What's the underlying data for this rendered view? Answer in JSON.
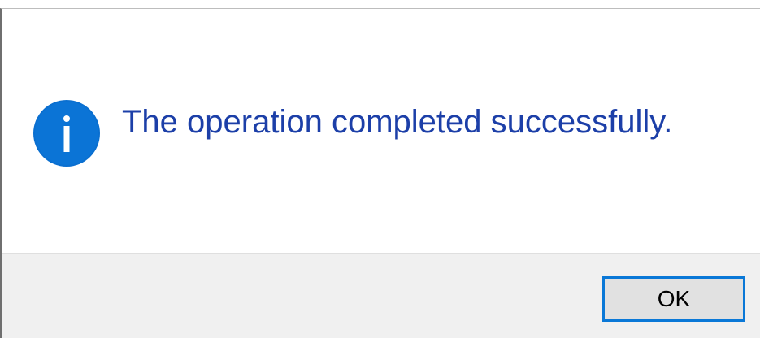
{
  "dialog": {
    "message": "The operation completed successfully.",
    "icon": "info-icon",
    "ok_label": "OK"
  },
  "colors": {
    "message_text": "#1c3fa8",
    "icon_fill": "#0a6fd0",
    "button_border": "#0a78d7",
    "footer_bg": "#f0f0f0",
    "button_bg": "#e1e1e1"
  }
}
